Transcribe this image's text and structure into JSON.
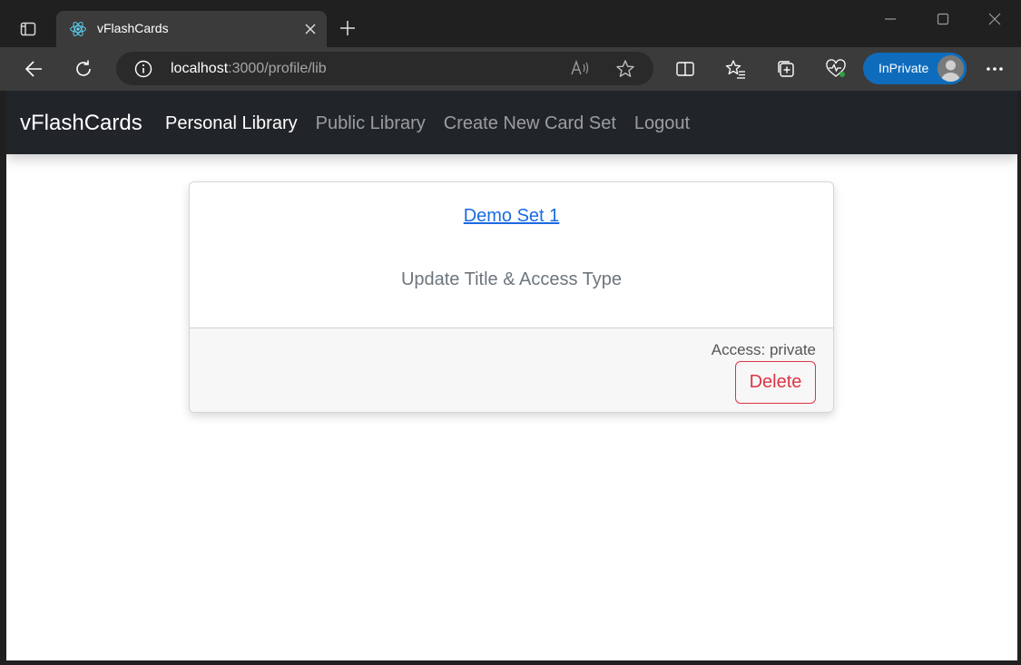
{
  "browser": {
    "tab": {
      "title": "vFlashCards",
      "favicon": "react-logo-icon"
    },
    "address": {
      "host": "localhost",
      "path": ":3000/profile/lib"
    },
    "inprivate_label": "InPrivate",
    "colors": {
      "frame": "#202020",
      "toolbar": "#3b3b3b",
      "inprivate": "#0f6cbd"
    }
  },
  "navbar": {
    "brand": "vFlashCards",
    "links": [
      {
        "label": "Personal Library",
        "active": true
      },
      {
        "label": "Public Library",
        "active": false
      },
      {
        "label": "Create New Card Set",
        "active": false
      },
      {
        "label": "Logout",
        "active": false
      }
    ],
    "colors": {
      "background": "#212529"
    }
  },
  "card": {
    "title": "Demo Set 1",
    "subtitle": "Update Title & Access Type",
    "access": "Access: private",
    "delete_label": "Delete",
    "colors": {
      "link": "#1a6be0",
      "danger": "#dc3545"
    }
  }
}
